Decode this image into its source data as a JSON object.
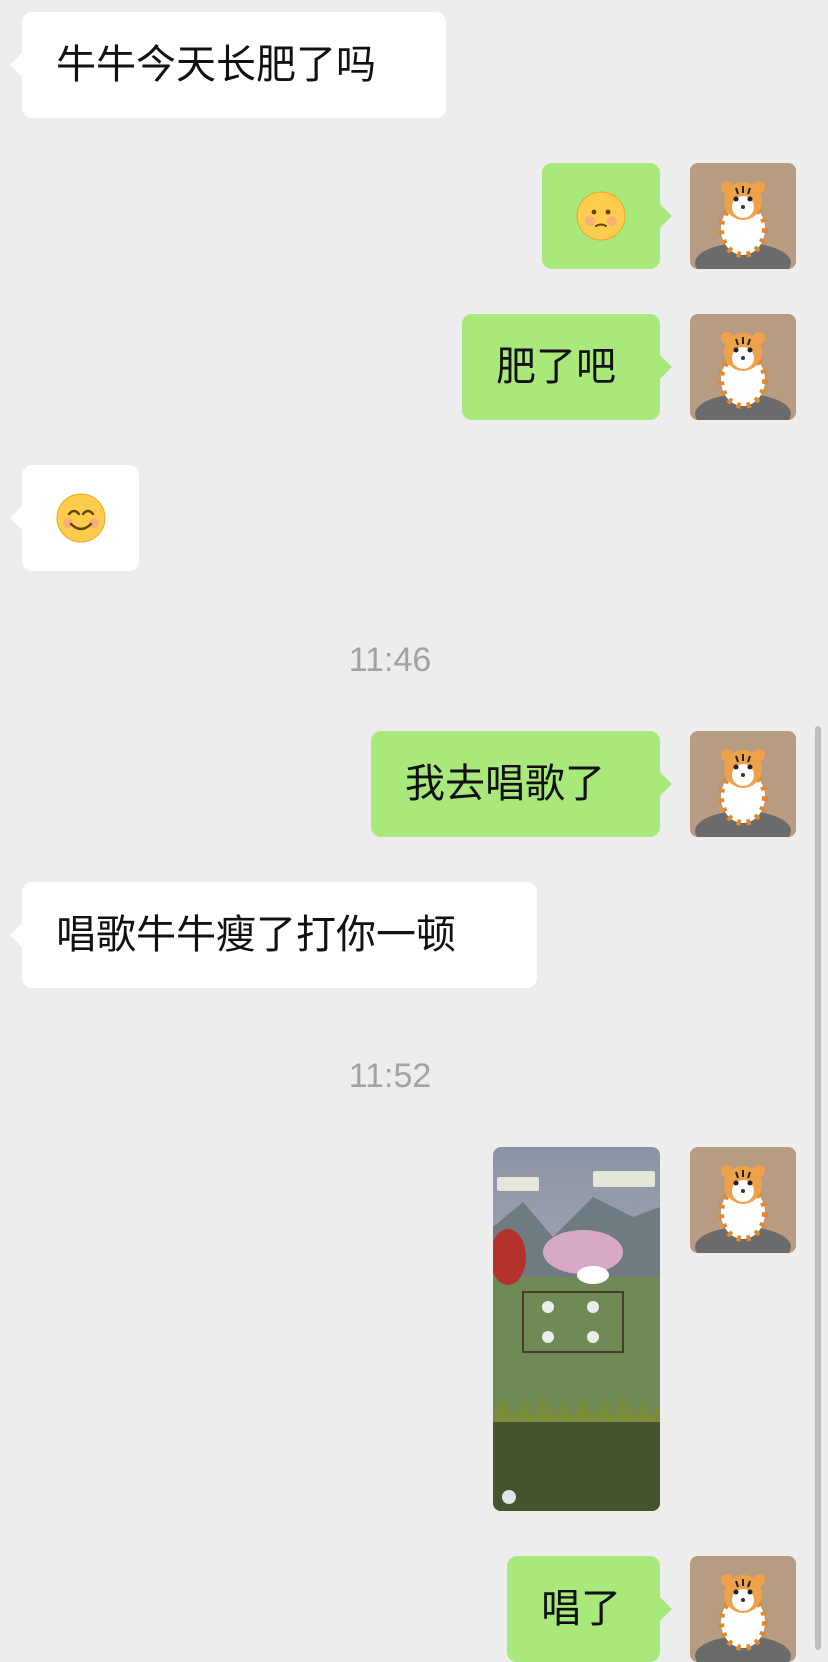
{
  "messages": {
    "m1": {
      "text": "牛牛今天长肥了吗"
    },
    "m2": {
      "emoji_name": "pleading-face-emoji"
    },
    "m3": {
      "text": "肥了吧"
    },
    "m4": {
      "emoji_name": "smiling-face-with-smiling-eyes-emoji"
    },
    "m5": {
      "text": "我去唱歌了"
    },
    "m6": {
      "text": "唱歌牛牛瘦了打你一顿"
    },
    "m8": {
      "text": "唱了"
    }
  },
  "timestamps": {
    "t1": "11:46",
    "t2": "11:52"
  },
  "image_message": {
    "description_icon": "game-screenshot-image"
  },
  "colors": {
    "background": "#ededed",
    "incoming_bubble": "#ffffff",
    "outgoing_bubble": "#a9e97c",
    "timestamp": "#a3a3a3"
  }
}
